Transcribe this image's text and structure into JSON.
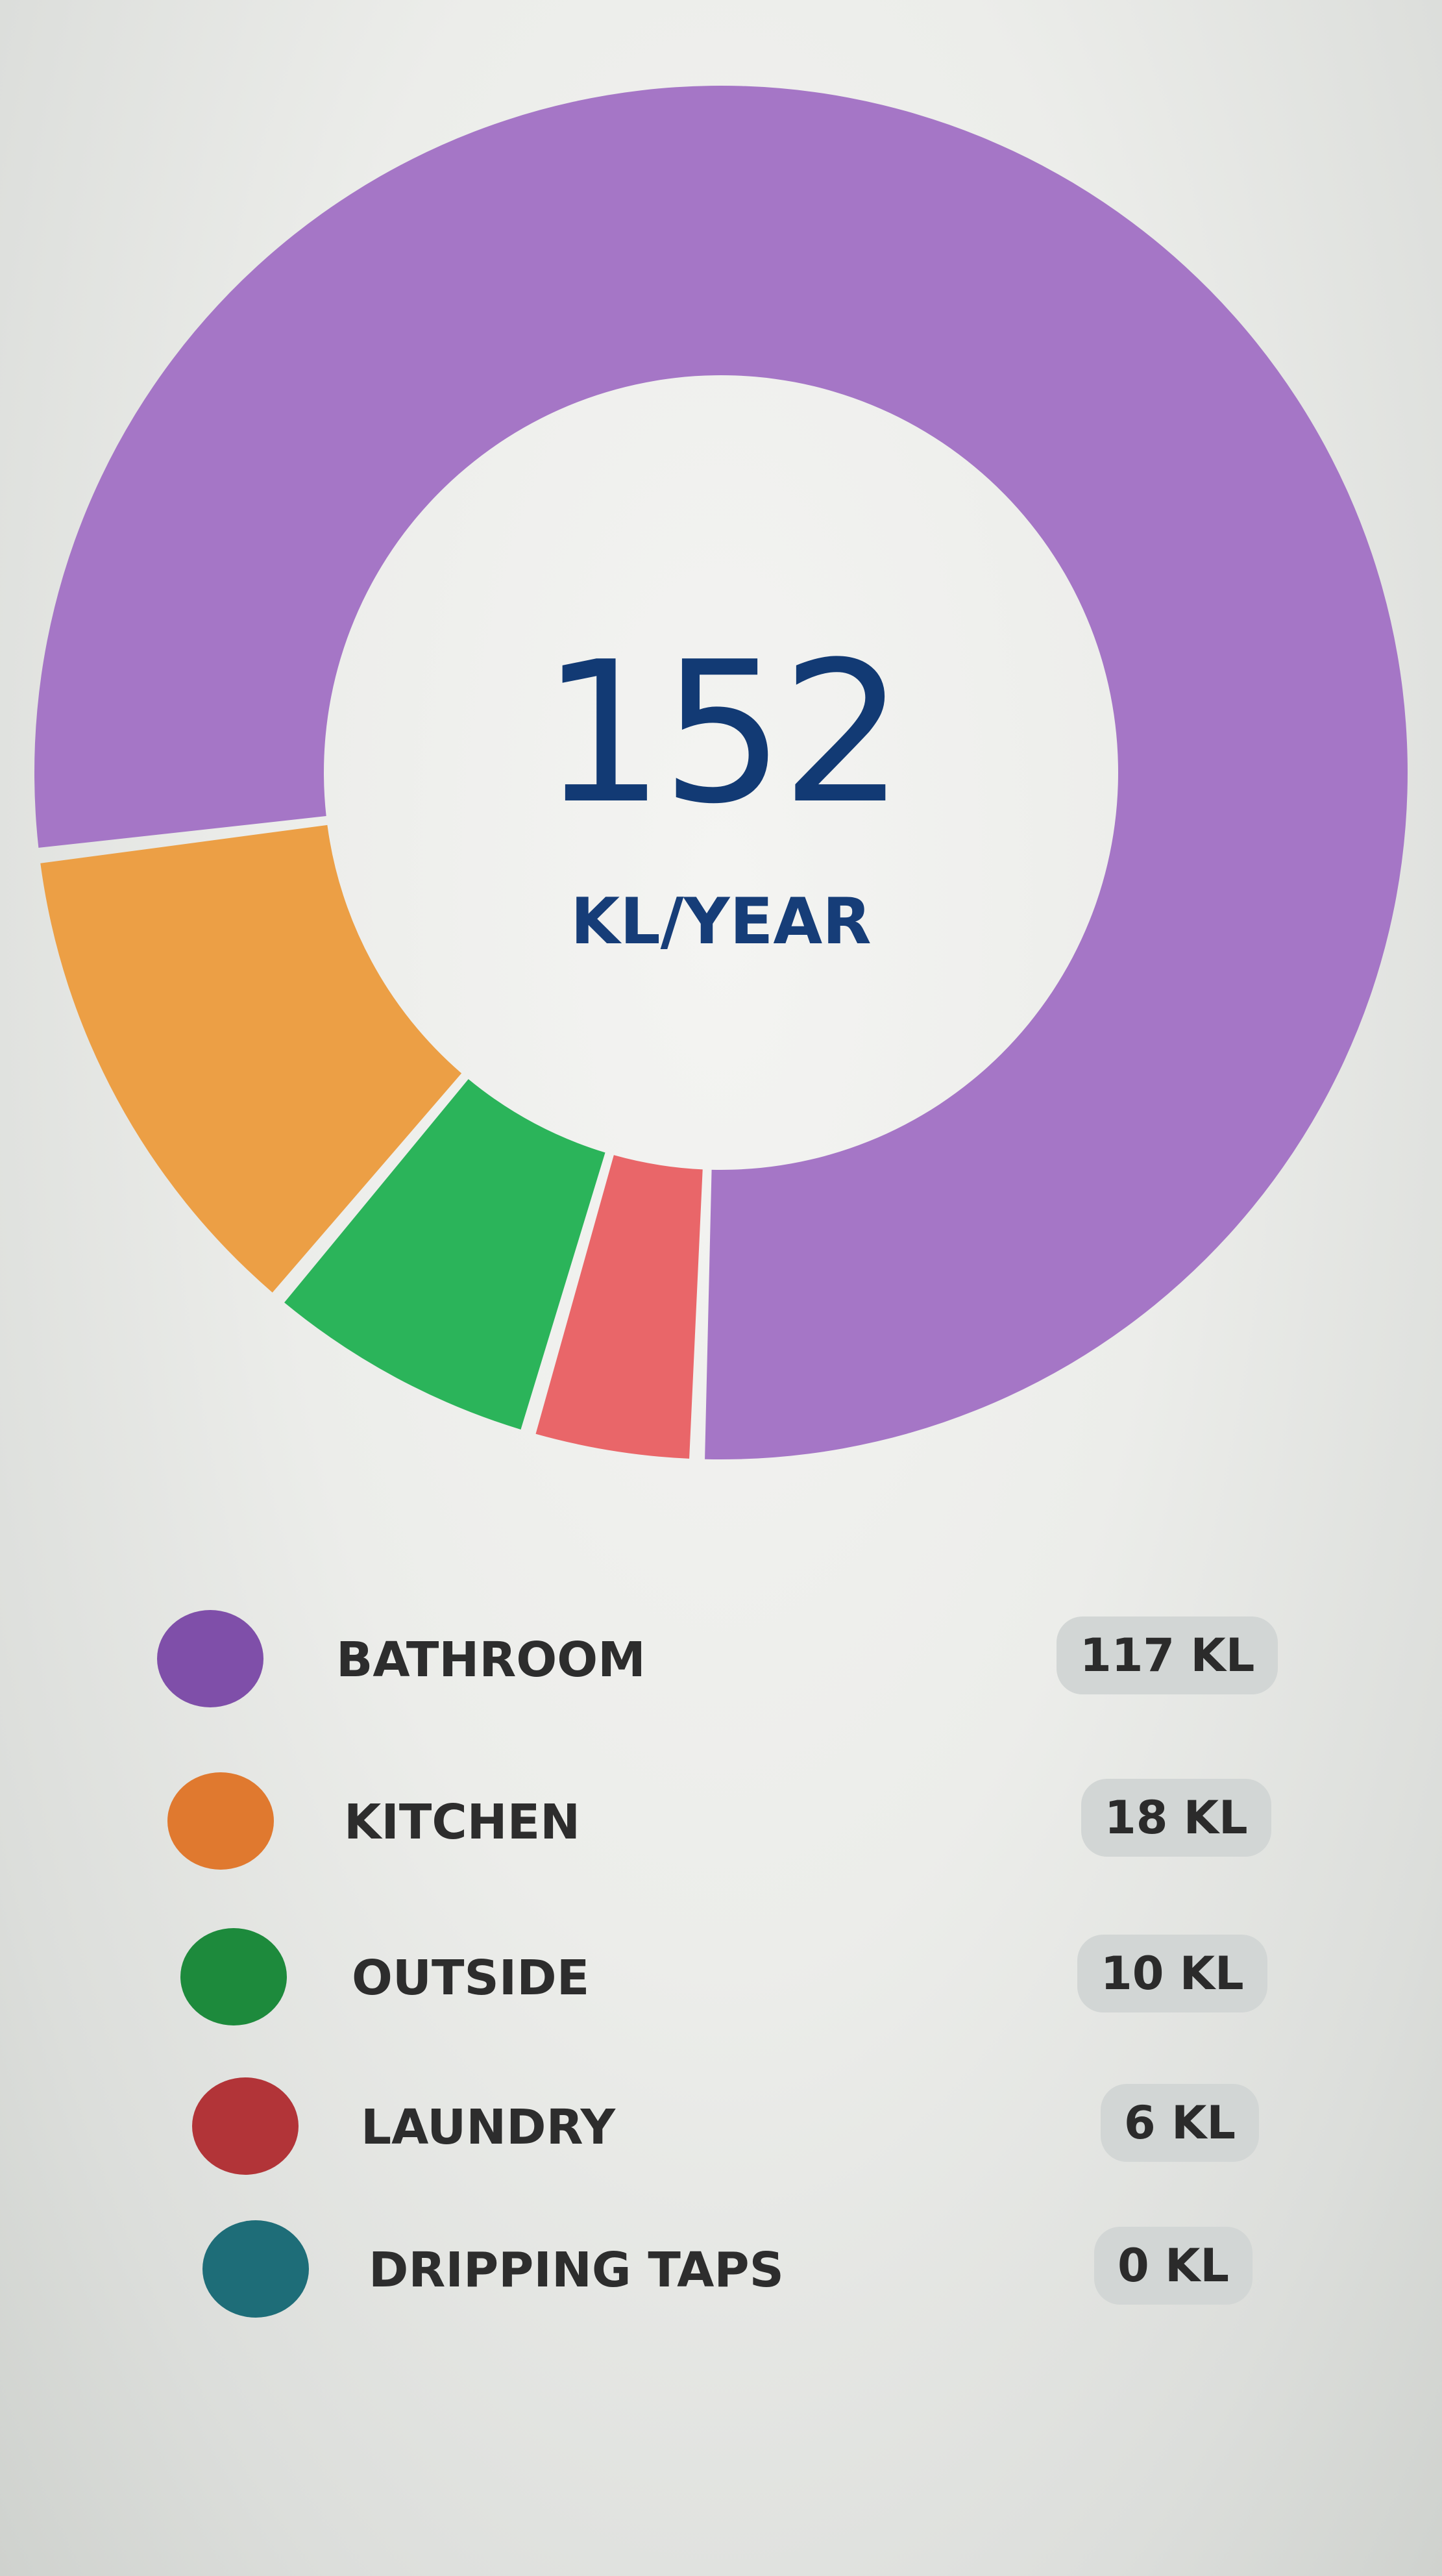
{
  "chart_data": {
    "type": "pie",
    "center_value": "152",
    "center_unit": "KL/YEAR",
    "categories": [
      "BATHROOM",
      "KITCHEN",
      "OUTSIDE",
      "LAUNDRY",
      "DRIPPING TAPS"
    ],
    "values": [
      117,
      18,
      10,
      6,
      0
    ],
    "value_labels": [
      "117 KL",
      "18 KL",
      "10 KL",
      "6 KL",
      "0 KL"
    ],
    "colors": [
      "#a576c6",
      "#ec9f45",
      "#2bb45a",
      "#e96669",
      "#1f6e78"
    ],
    "legend_colors": [
      "#7f4fa9",
      "#e0792f",
      "#1d8a3c",
      "#b23438",
      "#1e6d78"
    ]
  }
}
